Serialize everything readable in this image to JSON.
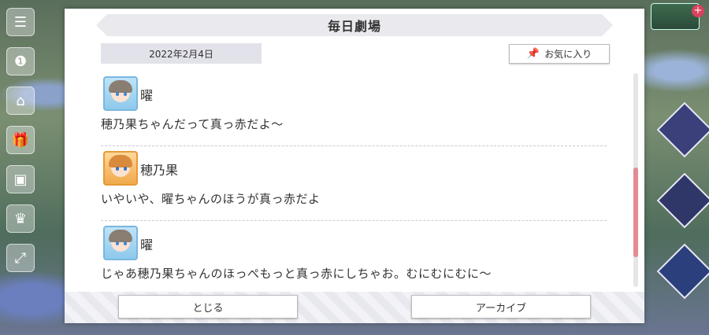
{
  "dialog": {
    "title": "毎日劇場",
    "date": "2022年2月4日",
    "favorite_label": "お気に入り",
    "favorite_icon": "pin-icon"
  },
  "entries": [
    {
      "speaker": "曜",
      "avatar": "you",
      "text": "穂乃果ちゃんだって真っ赤だよ〜"
    },
    {
      "speaker": "穂乃果",
      "avatar": "honoka",
      "text": "いやいや、曜ちゃんのほうが真っ赤だよ"
    },
    {
      "speaker": "曜",
      "avatar": "you",
      "text": "じゃあ穂乃果ちゃんのほっぺもっと真っ赤にしちゃお。むにむにむに〜"
    }
  ],
  "footer": {
    "close_label": "とじる",
    "archive_label": "アーカイブ"
  },
  "colors": {
    "scroll_thumb": "#e58b93",
    "title_bar": "#e9e9ee"
  }
}
